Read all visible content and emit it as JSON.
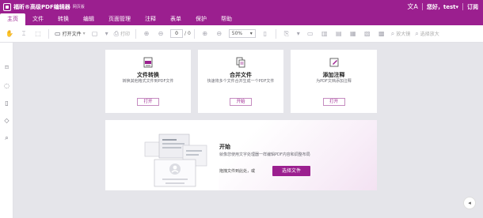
{
  "app": {
    "title": "福昕®高级PDF编辑器",
    "edition": "网页版",
    "greeting": "您好，test",
    "greeting_caret": "▾",
    "subscribe": "订阅"
  },
  "menu": {
    "items": [
      "主页",
      "文件",
      "转换",
      "编辑",
      "页面管理",
      "注释",
      "表单",
      "保护",
      "帮助"
    ],
    "active": "主页"
  },
  "toolbar": {
    "open_file_label": "打开文件",
    "print_label": "打印",
    "page_current": "0",
    "page_total": "/ 0",
    "zoom_value": "50%",
    "zoom_in_label": "放大镜",
    "select_zoom_label": "选择放大"
  },
  "cards": [
    {
      "title": "文件转换",
      "desc": "转换其他格式文件到PDF文件",
      "button": "打开",
      "icon": "pdf-convert-icon"
    },
    {
      "title": "合并文件",
      "desc": "快速将多个文件合并生成一个PDF文件",
      "button": "开始",
      "icon": "merge-icon"
    },
    {
      "title": "添加注释",
      "desc": "为PDF文档添加注释",
      "button": "打开",
      "icon": "annotate-icon"
    }
  ],
  "start": {
    "title": "开始",
    "desc": "就像您使用文字处理器一样编辑PDF内容和调整布局",
    "drop_text": "拖拽文件到此处，或",
    "button": "选择文件"
  },
  "colors": {
    "brand": "#9b1f8f",
    "background": "#e5e5ea"
  }
}
